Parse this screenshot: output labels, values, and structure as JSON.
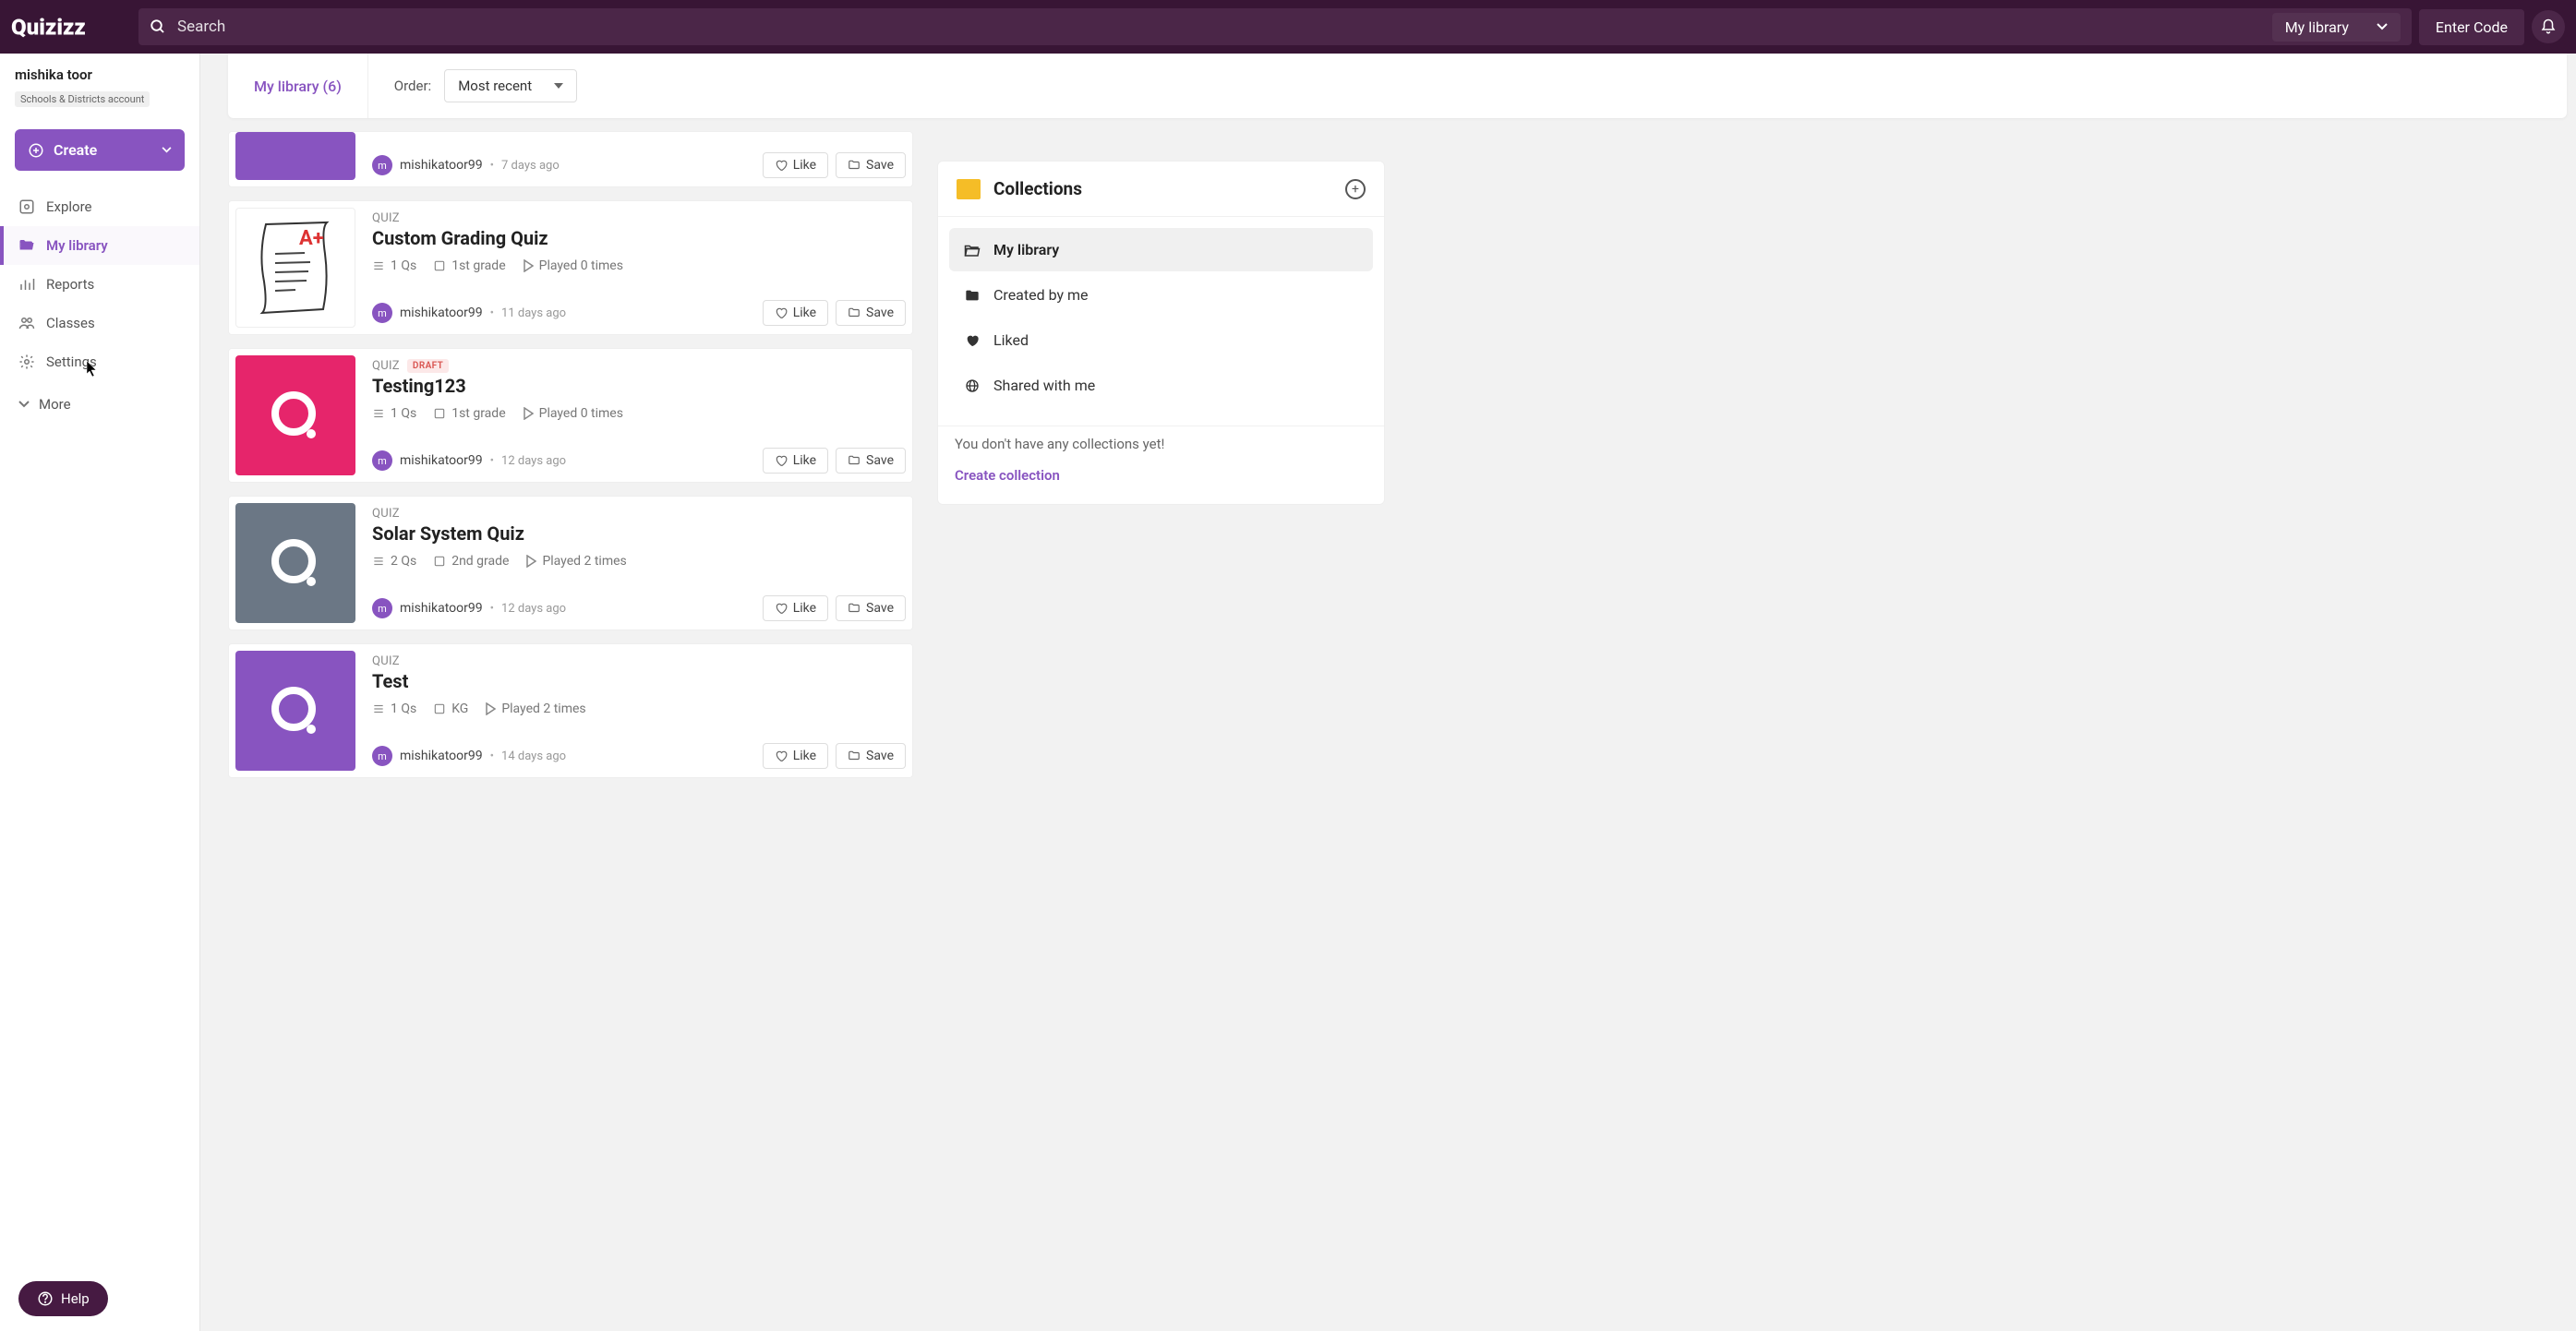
{
  "header": {
    "search_placeholder": "Search",
    "library_select_label": "My library",
    "enter_code_label": "Enter Code"
  },
  "sidebar": {
    "user_name": "mishika toor",
    "account_type": "Schools & Districts account",
    "create_label": "Create",
    "nav": [
      {
        "id": "explore",
        "label": "Explore",
        "icon": "compass-icon"
      },
      {
        "id": "my-library",
        "label": "My library",
        "icon": "folder-open-icon",
        "active": true
      },
      {
        "id": "reports",
        "label": "Reports",
        "icon": "chart-icon"
      },
      {
        "id": "classes",
        "label": "Classes",
        "icon": "people-icon"
      },
      {
        "id": "settings",
        "label": "Settings",
        "icon": "gear-icon"
      }
    ],
    "more_label": "More",
    "help_label": "Help"
  },
  "subheader": {
    "breadcrumb": "My library (6)",
    "order_label": "Order:",
    "order_value": "Most recent"
  },
  "quizzes": [
    {
      "type_label": "",
      "title": "",
      "author": "mishikatoor99",
      "time": "7 days ago",
      "like": "Like",
      "save": "Save",
      "partial": true,
      "thumb": "purple"
    },
    {
      "type_label": "QUIZ",
      "title": "Custom Grading Quiz",
      "qs": "1 Qs",
      "grade": "1st grade",
      "played": "Played 0 times",
      "author": "mishikatoor99",
      "time": "11 days ago",
      "like": "Like",
      "save": "Save",
      "thumb": "doc"
    },
    {
      "type_label": "QUIZ",
      "draft": "DRAFT",
      "title": "Testing123",
      "qs": "1 Qs",
      "grade": "1st grade",
      "played": "Played 0 times",
      "author": "mishikatoor99",
      "time": "12 days ago",
      "like": "Like",
      "save": "Save",
      "thumb": "pink"
    },
    {
      "type_label": "QUIZ",
      "title": "Solar System Quiz",
      "qs": "2 Qs",
      "grade": "2nd grade",
      "played": "Played 2 times",
      "author": "mishikatoor99",
      "time": "12 days ago",
      "like": "Like",
      "save": "Save",
      "thumb": "slate"
    },
    {
      "type_label": "QUIZ",
      "title": "Test",
      "qs": "1 Qs",
      "grade": "KG",
      "played": "Played 2 times",
      "author": "mishikatoor99",
      "time": "14 days ago",
      "like": "Like",
      "save": "Save",
      "thumb": "purple"
    }
  ],
  "collections": {
    "title": "Collections",
    "items": [
      {
        "id": "my-library",
        "label": "My library",
        "icon": "folder-open-icon",
        "active": true
      },
      {
        "id": "created-by-me",
        "label": "Created by me",
        "icon": "folder-icon"
      },
      {
        "id": "liked",
        "label": "Liked",
        "icon": "heart-icon"
      },
      {
        "id": "shared-with-me",
        "label": "Shared with me",
        "icon": "globe-icon"
      }
    ],
    "empty_text": "You don't have any collections yet!",
    "create_label": "Create collection"
  }
}
